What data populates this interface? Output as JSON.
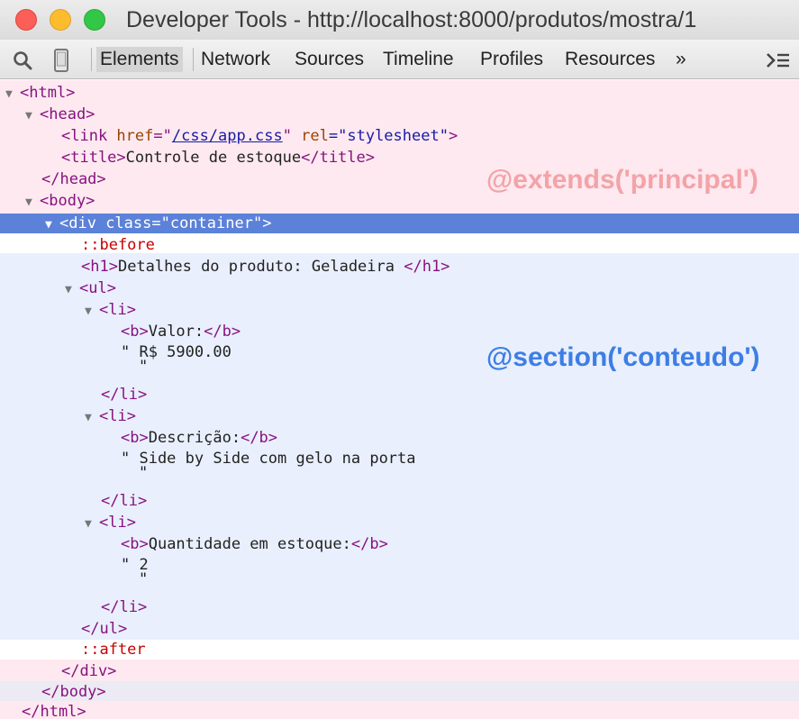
{
  "window": {
    "title": "Developer Tools - http://localhost:8000/produtos/mostra/1"
  },
  "toolbar": {
    "tabs": [
      "Elements",
      "Network",
      "Sources",
      "Timeline",
      "Profiles",
      "Resources"
    ],
    "active_tab": "Elements",
    "more_label": "»",
    "icons": [
      "search-icon",
      "device-icon",
      "console-drawer-icon"
    ]
  },
  "tree": {
    "html_open": "<html>",
    "head_open": "<head>",
    "link": {
      "open": "<link ",
      "href_attr": "href",
      "eq_quote": "=\"",
      "href_value": "/css/app.css",
      "mid": "\" ",
      "rel_attr": "rel",
      "rel_value": "=\"stylesheet\"",
      "close": ">"
    },
    "title": {
      "open": "<title>",
      "text": "Controle de estoque",
      "close": "</title>"
    },
    "head_close": "</head>",
    "body_open": "<body>",
    "div": {
      "open": "<div ",
      "class_attr": "class",
      "class_value": "=\"container\"",
      "close": ">"
    },
    "before": "::before",
    "h1": {
      "open": "<h1>",
      "text": "Detalhes do produto: Geladeira ",
      "close": "</h1>"
    },
    "ul_open": "<ul>",
    "li_open": "<li>",
    "li_close": "</li>",
    "b_open": "<b>",
    "b_close": "</b>",
    "items": [
      {
        "label": "Valor:",
        "value": "\" R$ 5900.00"
      },
      {
        "label": "Descrição:",
        "value": "\" Side by Side com gelo na porta"
      },
      {
        "label": "Quantidade em estoque:",
        "value": "\" 2"
      }
    ],
    "quote": "\"",
    "ul_close": "</ul>",
    "after": "::after",
    "div_close": "</div>",
    "body_close": "</body>",
    "html_close": "</html>"
  },
  "annotations": {
    "extends": "@extends('principal')",
    "section": "@section('conteudo')"
  },
  "colors": {
    "pink_band": "#fde9ef",
    "blue_band": "#e9effd",
    "selection": "#5b81d9",
    "extends_text": "#f3a3a8",
    "section_text": "#3d7ee6"
  }
}
